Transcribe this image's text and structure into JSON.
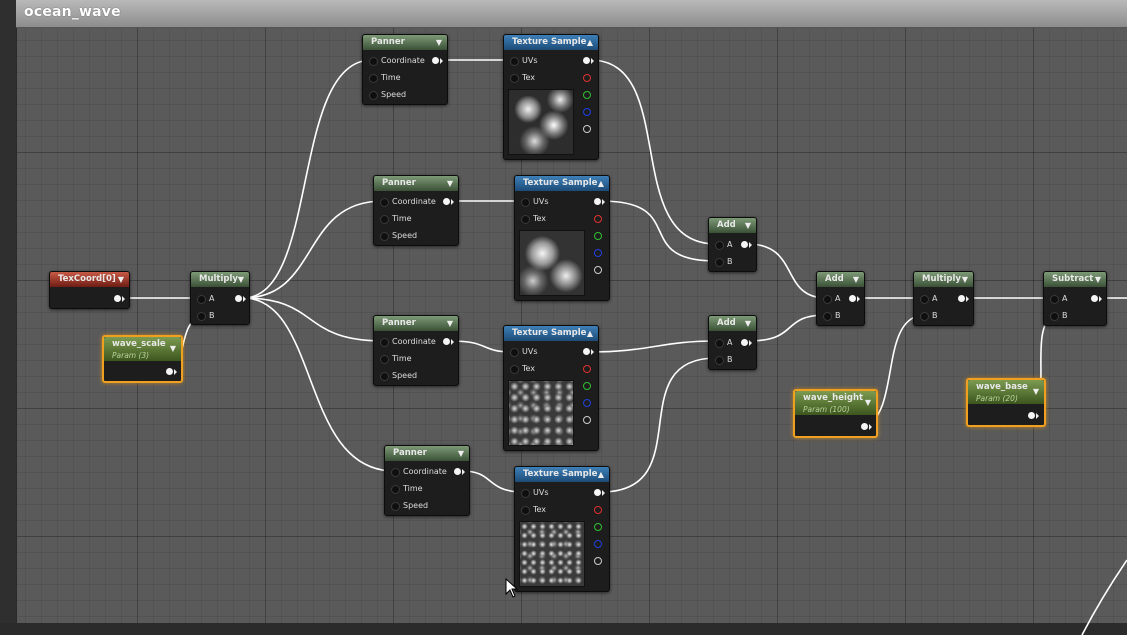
{
  "window": {
    "title": "ocean_wave"
  },
  "nodes": {
    "texcoord": {
      "label": "TexCoord[0]"
    },
    "multiply1": {
      "label": "Multiply",
      "pin_a": "A",
      "pin_b": "B"
    },
    "wave_scale": {
      "label": "wave_scale",
      "sub": "Param (3)"
    },
    "panner1": {
      "label": "Panner",
      "coord": "Coordinate",
      "time": "Time",
      "speed": "Speed"
    },
    "panner2": {
      "label": "Panner",
      "coord": "Coordinate",
      "time": "Time",
      "speed": "Speed"
    },
    "panner3": {
      "label": "Panner",
      "coord": "Coordinate",
      "time": "Time",
      "speed": "Speed"
    },
    "panner4": {
      "label": "Panner",
      "coord": "Coordinate",
      "time": "Time",
      "speed": "Speed"
    },
    "tex1": {
      "label": "Texture Sample",
      "uvs": "UVs",
      "tex": "Tex"
    },
    "tex2": {
      "label": "Texture Sample",
      "uvs": "UVs",
      "tex": "Tex"
    },
    "tex3": {
      "label": "Texture Sample",
      "uvs": "UVs",
      "tex": "Tex"
    },
    "tex4": {
      "label": "Texture Sample",
      "uvs": "UVs",
      "tex": "Tex"
    },
    "add1": {
      "label": "Add",
      "pin_a": "A",
      "pin_b": "B"
    },
    "add2": {
      "label": "Add",
      "pin_a": "A",
      "pin_b": "B"
    },
    "add3": {
      "label": "Add",
      "pin_a": "A",
      "pin_b": "B"
    },
    "multiply2": {
      "label": "Multiply",
      "pin_a": "A",
      "pin_b": "B"
    },
    "wave_height": {
      "label": "wave_height",
      "sub": "Param (100)"
    },
    "wave_base": {
      "label": "wave_base",
      "sub": "Param (20)"
    },
    "subtract": {
      "label": "Subtract",
      "pin_a": "A",
      "pin_b": "B"
    }
  },
  "colors": {
    "param_border": "#f0a020",
    "pin_red": "#e03030",
    "pin_green": "#30c030",
    "pin_blue": "#2040e0",
    "pin_alpha": "#cccccc"
  }
}
